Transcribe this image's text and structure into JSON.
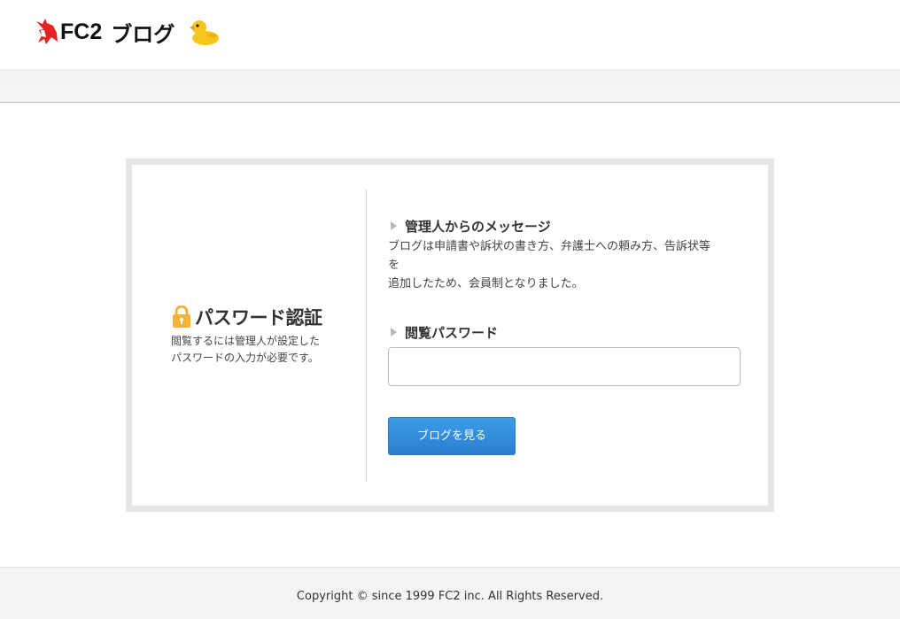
{
  "header": {
    "logo_brand": "FC2",
    "logo_product": "ブログ",
    "logo_icon": "fc2-unicorn-icon",
    "mascot_icon": "duck-icon"
  },
  "auth": {
    "icon": "lock-icon",
    "title": "パスワード認証",
    "description_line1": "閲覧するには管理人が設定した",
    "description_line2": "パスワードの入力が必要です。"
  },
  "message": {
    "label": "管理人からのメッセージ",
    "line1": "ブログは申請書や訴状の書き方、弁護士への頼み方、告訴状等",
    "line2": "を",
    "line3": "追加したため、会員制となりました。"
  },
  "password": {
    "label": "閲覧パスワード",
    "value": ""
  },
  "submit": {
    "label": "ブログを見る"
  },
  "footer": {
    "copyright": "Copyright © since 1999 FC2 inc. All Rights Reserved."
  },
  "colors": {
    "button": "#2b8ddd",
    "lock": "#f5b335",
    "logo_red": "#e32424",
    "duck": "#f7c61b"
  }
}
